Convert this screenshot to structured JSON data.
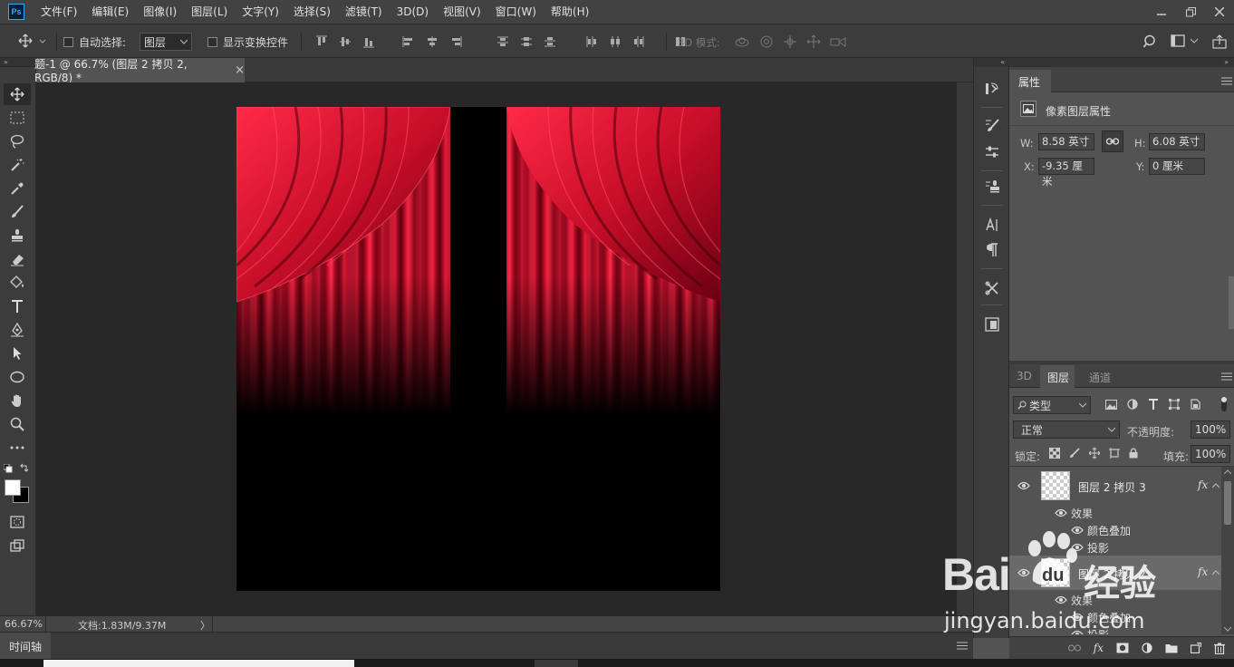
{
  "app": {
    "logo": "Ps"
  },
  "menu": [
    "文件(F)",
    "编辑(E)",
    "图像(I)",
    "图层(L)",
    "文字(Y)",
    "选择(S)",
    "滤镜(T)",
    "3D(D)",
    "视图(V)",
    "窗口(W)",
    "帮助(H)"
  ],
  "options": {
    "auto_select_label": "自动选择:",
    "auto_select_target": "图层",
    "show_transform_label": "显示变换控件",
    "mode_3d_label": "3D 模式:"
  },
  "document": {
    "tab_title": "题-1 @ 66.7% (图层 2 拷贝 2, RGB/8) *",
    "close_glyph": "×"
  },
  "status": {
    "zoom": "66.67%",
    "doc_size": "文档:1.83M/9.37M",
    "arrow": "〉"
  },
  "timeline": {
    "label": "时间轴"
  },
  "properties": {
    "tab": "属性",
    "subtitle": "像素图层属性",
    "w_label": "W:",
    "w_value": "8.58 英寸",
    "h_label": "H:",
    "h_value": "6.08 英寸",
    "x_label": "X:",
    "x_value": "-9.35 厘米",
    "y_label": "Y:",
    "y_value": "0 厘米"
  },
  "layers_panel": {
    "tabs": [
      "3D",
      "图层",
      "通道"
    ],
    "active_tab": "图层",
    "filter_kind": "类型",
    "blend_mode": "正常",
    "opacity_label": "不透明度:",
    "opacity_value": "100%",
    "lock_label": "锁定:",
    "fill_label": "填充:",
    "fill_value": "100%",
    "layers": [
      {
        "name": "图层 2 拷贝 3",
        "fx": "fx",
        "effects_label": "效果",
        "effects": [
          "颜色叠加",
          "投影"
        ]
      },
      {
        "name": "图层 2 拷贝 2",
        "fx": "fx",
        "effects_label": "效果",
        "effects": [
          "颜色叠加",
          "投影"
        ]
      }
    ]
  },
  "watermark": {
    "brand": "Bai",
    "brand2": "经验",
    "url": "jingyan.baidu.com"
  },
  "colors": {
    "curtain": "#d0102a",
    "curtain_dark": "#5a0010",
    "canvas_bg": "#282828",
    "panel": "#535353"
  }
}
